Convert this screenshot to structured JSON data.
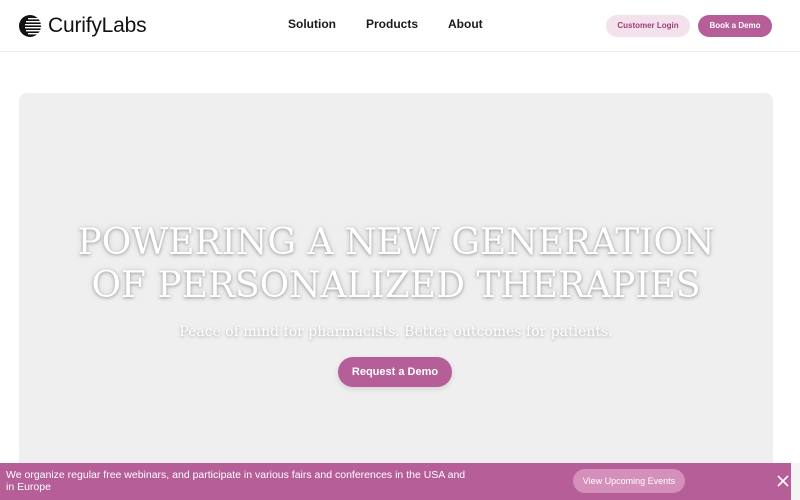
{
  "header": {
    "brand": "CurifyLabs",
    "nav": [
      "Solution",
      "Products",
      "About"
    ],
    "login_label": "Customer Login",
    "book_label": "Book a Demo"
  },
  "hero": {
    "title_line1": "POWERING A NEW GENERATION",
    "title_line2": "OF PERSONALIZED THERAPIES",
    "subtitle": "Peace of mind for pharmacists. Better outcomes for patients.",
    "cta_label": "Request a Demo"
  },
  "banner": {
    "text": "We organize regular free webinars, and participate in various fairs and conferences in the USA and in Europe",
    "button_label": "View Upcoming Events"
  },
  "colors": {
    "accent": "#b55e98",
    "accent_light": "#f3e1ec",
    "hero_bg": "#efefef"
  },
  "icons": [
    "curifylabs-logo-icon",
    "close-icon"
  ]
}
